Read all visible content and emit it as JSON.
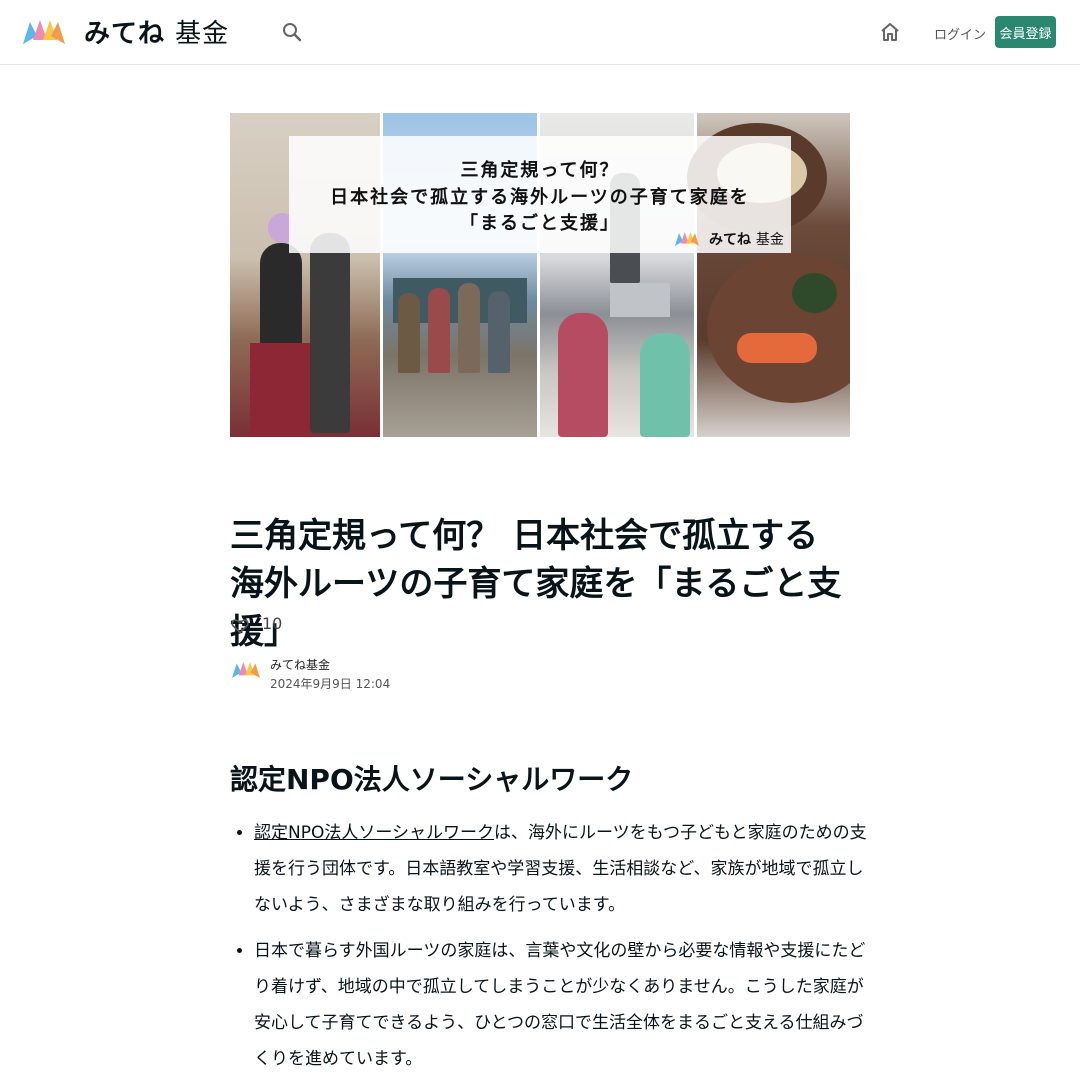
{
  "header": {
    "brand_bold": "みてね",
    "brand_light": "基金",
    "login_label": "ログイン",
    "signup_label": "会員登録"
  },
  "hero": {
    "line1": "三角定規って何？",
    "line2": "日本社会で孤立する海外ルーツの子育て家庭を",
    "line3": "「まるごと支援」",
    "brand_bold": "みてね",
    "brand_light": "基金"
  },
  "article": {
    "title": "三角定規って何？ 日本社会で孤立する海外ルーツの子育て家庭を「まるごと支援」",
    "likes": "10",
    "author": "みてね基金",
    "date": "2024年9月9日 12:04",
    "section_heading": "認定NPO法人ソーシャルワーク",
    "bullets": [
      {
        "link": "認定NPO法人ソーシャルワーク",
        "rest": "は、海外にルーツをもつ子どもと家庭のための支援を行う団体です。日本語教室や学習支援、生活相談など、家族が地域で孤立しないよう、さまざまな取り組みを行っています。"
      },
      {
        "rest": "日本で暮らす外国ルーツの家庭は、言葉や文化の壁から必要な情報や支援にたどり着けず、地域の中で孤立してしまうことが少なくありません。こうした家庭が安心して子育てできるよう、ひとつの窓口で生活全体をまるごと支える仕組みづくりを進めています。"
      }
    ]
  },
  "colors": {
    "accent": "#2a8770",
    "text": "#08131a"
  }
}
